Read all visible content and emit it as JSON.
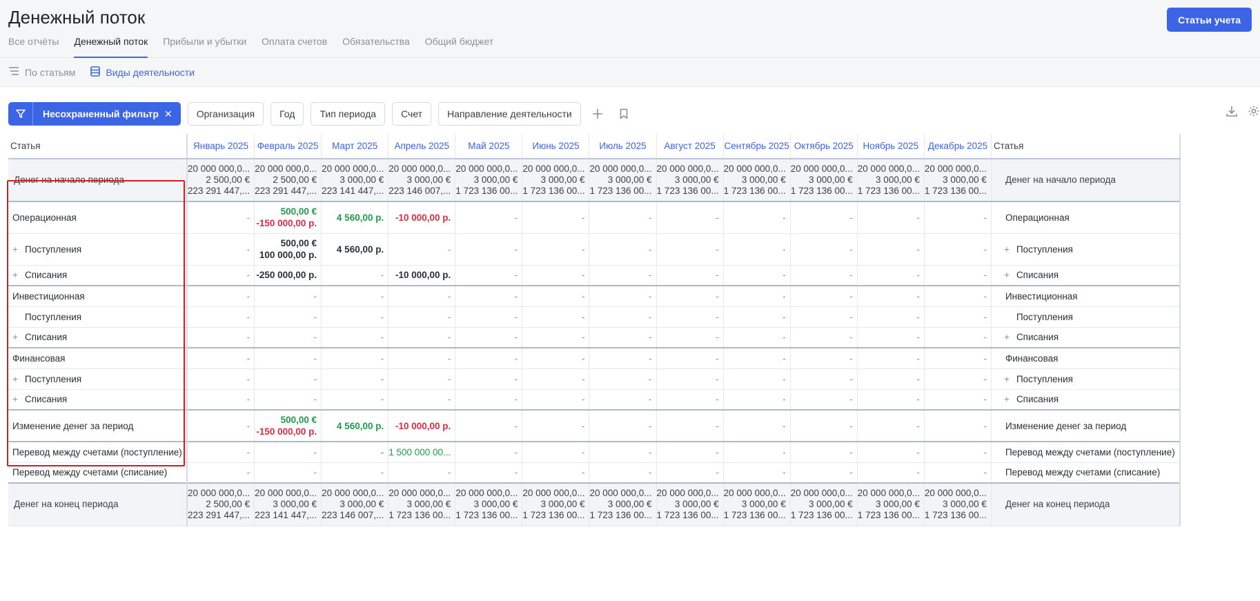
{
  "header": {
    "title": "Денежный поток",
    "primary_button": "Статьи учета",
    "tabs": [
      {
        "label": "Все отчёты"
      },
      {
        "label": "Денежный поток",
        "active": true
      },
      {
        "label": "Прибыли и убытки"
      },
      {
        "label": "Оплата счетов"
      },
      {
        "label": "Обязательства"
      },
      {
        "label": "Общий бюджет"
      }
    ]
  },
  "subnav": {
    "by_items": "По статьям",
    "activities": "Виды деятельности"
  },
  "filters": {
    "active_filter": "Несохраненный фильтр",
    "organization": "Организация",
    "year": "Год",
    "period_type": "Тип периода",
    "account": "Счет",
    "direction": "Направление деятельности"
  },
  "colors": {
    "accent": "#3b64e6",
    "positive": "#1e9d4b",
    "negative": "#e02a45",
    "highlight_box": "#d21d1d"
  },
  "table": {
    "label_header": "Статья",
    "months": [
      "Январь 2025",
      "Февраль 2025",
      "Март 2025",
      "Апрель 2025",
      "Май 2025",
      "Июнь 2025",
      "Июль 2025",
      "Август 2025",
      "Сентябрь 2025",
      "Октябрь 2025",
      "Ноябрь 2025",
      "Декабрь 2025"
    ],
    "start_label": "Денег на начало периода",
    "start_values": [
      [
        "20 000 000,0...",
        "2 500,00 €",
        "223 291 447,..."
      ],
      [
        "20 000 000,0...",
        "2 500,00 €",
        "223 291 447,..."
      ],
      [
        "20 000 000,0...",
        "3 000,00 €",
        "223 141 447,..."
      ],
      [
        "20 000 000,0...",
        "3 000,00 €",
        "223 146 007,..."
      ],
      [
        "20 000 000,0...",
        "3 000,00 €",
        "1 723 136 00..."
      ],
      [
        "20 000 000,0...",
        "3 000,00 €",
        "1 723 136 00..."
      ],
      [
        "20 000 000,0...",
        "3 000,00 €",
        "1 723 136 00..."
      ],
      [
        "20 000 000,0...",
        "3 000,00 €",
        "1 723 136 00..."
      ],
      [
        "20 000 000,0...",
        "3 000,00 €",
        "1 723 136 00..."
      ],
      [
        "20 000 000,0...",
        "3 000,00 €",
        "1 723 136 00..."
      ],
      [
        "20 000 000,0...",
        "3 000,00 €",
        "1 723 136 00..."
      ],
      [
        "20 000 000,0...",
        "3 000,00 €",
        "1 723 136 00..."
      ]
    ],
    "end_label": "Денег на конец периода",
    "end_values": [
      [
        "20 000 000,0...",
        "2 500,00 €",
        "223 291 447,..."
      ],
      [
        "20 000 000,0...",
        "3 000,00 €",
        "223 141 447,..."
      ],
      [
        "20 000 000,0...",
        "3 000,00 €",
        "223 146 007,..."
      ],
      [
        "20 000 000,0...",
        "3 000,00 €",
        "1 723 136 00..."
      ],
      [
        "20 000 000,0...",
        "3 000,00 €",
        "1 723 136 00..."
      ],
      [
        "20 000 000,0...",
        "3 000,00 €",
        "1 723 136 00..."
      ],
      [
        "20 000 000,0...",
        "3 000,00 €",
        "1 723 136 00..."
      ],
      [
        "20 000 000,0...",
        "3 000,00 €",
        "1 723 136 00..."
      ],
      [
        "20 000 000,0...",
        "3 000,00 €",
        "1 723 136 00..."
      ],
      [
        "20 000 000,0...",
        "3 000,00 €",
        "1 723 136 00..."
      ],
      [
        "20 000 000,0...",
        "3 000,00 €",
        "1 723 136 00..."
      ],
      [
        "20 000 000,0...",
        "3 000,00 €",
        "1 723 136 00..."
      ]
    ],
    "rows": [
      {
        "label": "Операционная",
        "kind": "group",
        "cells": [
          [
            {
              "t": "-",
              "c": "dash"
            }
          ],
          [
            {
              "t": "500,00 €",
              "c": "pos"
            },
            {
              "t": "-150 000,00 р.",
              "c": "neg"
            }
          ],
          [
            {
              "t": "4 560,00 р.",
              "c": "pos"
            }
          ],
          [
            {
              "t": "-10 000,00 р.",
              "c": "neg"
            }
          ],
          [
            {
              "t": "-",
              "c": "dash"
            }
          ],
          [
            {
              "t": "-",
              "c": "dash"
            }
          ],
          [
            {
              "t": "-",
              "c": "dash"
            }
          ],
          [
            {
              "t": "-",
              "c": "dash"
            }
          ],
          [
            {
              "t": "-",
              "c": "dash"
            }
          ],
          [
            {
              "t": "-",
              "c": "dash"
            }
          ],
          [
            {
              "t": "-",
              "c": "dash"
            }
          ],
          [
            {
              "t": "-",
              "c": "dash"
            }
          ]
        ]
      },
      {
        "label": "Поступления",
        "kind": "sub",
        "plus": true,
        "cells": [
          [
            {
              "t": "-",
              "c": "dash"
            }
          ],
          [
            {
              "t": "500,00 €",
              "c": "bold"
            },
            {
              "t": "100 000,00 р.",
              "c": "bold"
            }
          ],
          [
            {
              "t": "4 560,00 р.",
              "c": "bold"
            }
          ],
          [
            {
              "t": "-",
              "c": "dash"
            }
          ],
          [
            {
              "t": "-",
              "c": "dash"
            }
          ],
          [
            {
              "t": "-",
              "c": "dash"
            }
          ],
          [
            {
              "t": "-",
              "c": "dash"
            }
          ],
          [
            {
              "t": "-",
              "c": "dash"
            }
          ],
          [
            {
              "t": "-",
              "c": "dash"
            }
          ],
          [
            {
              "t": "-",
              "c": "dash"
            }
          ],
          [
            {
              "t": "-",
              "c": "dash"
            }
          ],
          [
            {
              "t": "-",
              "c": "dash"
            }
          ]
        ]
      },
      {
        "label": "Списания",
        "kind": "sub",
        "plus": true,
        "cells": [
          [
            {
              "t": "-",
              "c": "dash"
            }
          ],
          [
            {
              "t": "-250 000,00 р.",
              "c": "bold"
            }
          ],
          [
            {
              "t": "-",
              "c": "dash"
            }
          ],
          [
            {
              "t": "-10 000,00 р.",
              "c": "bold"
            }
          ],
          [
            {
              "t": "-",
              "c": "dash"
            }
          ],
          [
            {
              "t": "-",
              "c": "dash"
            }
          ],
          [
            {
              "t": "-",
              "c": "dash"
            }
          ],
          [
            {
              "t": "-",
              "c": "dash"
            }
          ],
          [
            {
              "t": "-",
              "c": "dash"
            }
          ],
          [
            {
              "t": "-",
              "c": "dash"
            }
          ],
          [
            {
              "t": "-",
              "c": "dash"
            }
          ],
          [
            {
              "t": "-",
              "c": "dash"
            }
          ]
        ]
      },
      {
        "label": "Инвестиционная",
        "kind": "group",
        "cells": "dashes"
      },
      {
        "label": "Поступления",
        "kind": "sub",
        "plus": false,
        "cells": "dashes"
      },
      {
        "label": "Списания",
        "kind": "sub",
        "plus": true,
        "cells": "dashes"
      },
      {
        "label": "Финансовая",
        "kind": "group",
        "cells": "dashes"
      },
      {
        "label": "Поступления",
        "kind": "sub",
        "plus": true,
        "cells": "dashes"
      },
      {
        "label": "Списания",
        "kind": "sub",
        "plus": true,
        "cells": "dashes"
      },
      {
        "label": "Изменение денег за период",
        "kind": "group",
        "cells": [
          [
            {
              "t": "-",
              "c": "dash"
            }
          ],
          [
            {
              "t": "500,00 €",
              "c": "pos"
            },
            {
              "t": "-150 000,00 р.",
              "c": "neg"
            }
          ],
          [
            {
              "t": "4 560,00 р.",
              "c": "pos"
            }
          ],
          [
            {
              "t": "-10 000,00 р.",
              "c": "neg"
            }
          ],
          [
            {
              "t": "-",
              "c": "dash"
            }
          ],
          [
            {
              "t": "-",
              "c": "dash"
            }
          ],
          [
            {
              "t": "-",
              "c": "dash"
            }
          ],
          [
            {
              "t": "-",
              "c": "dash"
            }
          ],
          [
            {
              "t": "-",
              "c": "dash"
            }
          ],
          [
            {
              "t": "-",
              "c": "dash"
            }
          ],
          [
            {
              "t": "-",
              "c": "dash"
            }
          ],
          [
            {
              "t": "-",
              "c": "dash"
            }
          ]
        ]
      },
      {
        "label": "Перевод между счетами (поступление)",
        "kind": "transfer",
        "cells": [
          [
            {
              "t": "-",
              "c": "dash"
            }
          ],
          [
            {
              "t": "-",
              "c": "dash"
            }
          ],
          [
            {
              "t": "-",
              "c": "posl"
            }
          ],
          [
            {
              "t": "1 500 000 00...",
              "c": "posl"
            }
          ],
          [
            {
              "t": "-",
              "c": "dash"
            }
          ],
          [
            {
              "t": "-",
              "c": "dash"
            }
          ],
          [
            {
              "t": "-",
              "c": "dash"
            }
          ],
          [
            {
              "t": "-",
              "c": "dash"
            }
          ],
          [
            {
              "t": "-",
              "c": "dash"
            }
          ],
          [
            {
              "t": "-",
              "c": "dash"
            }
          ],
          [
            {
              "t": "-",
              "c": "dash"
            }
          ],
          [
            {
              "t": "-",
              "c": "dash"
            }
          ]
        ]
      },
      {
        "label": "Перевод между счетами (списание)",
        "kind": "transfer",
        "cells": "dashes"
      }
    ]
  }
}
